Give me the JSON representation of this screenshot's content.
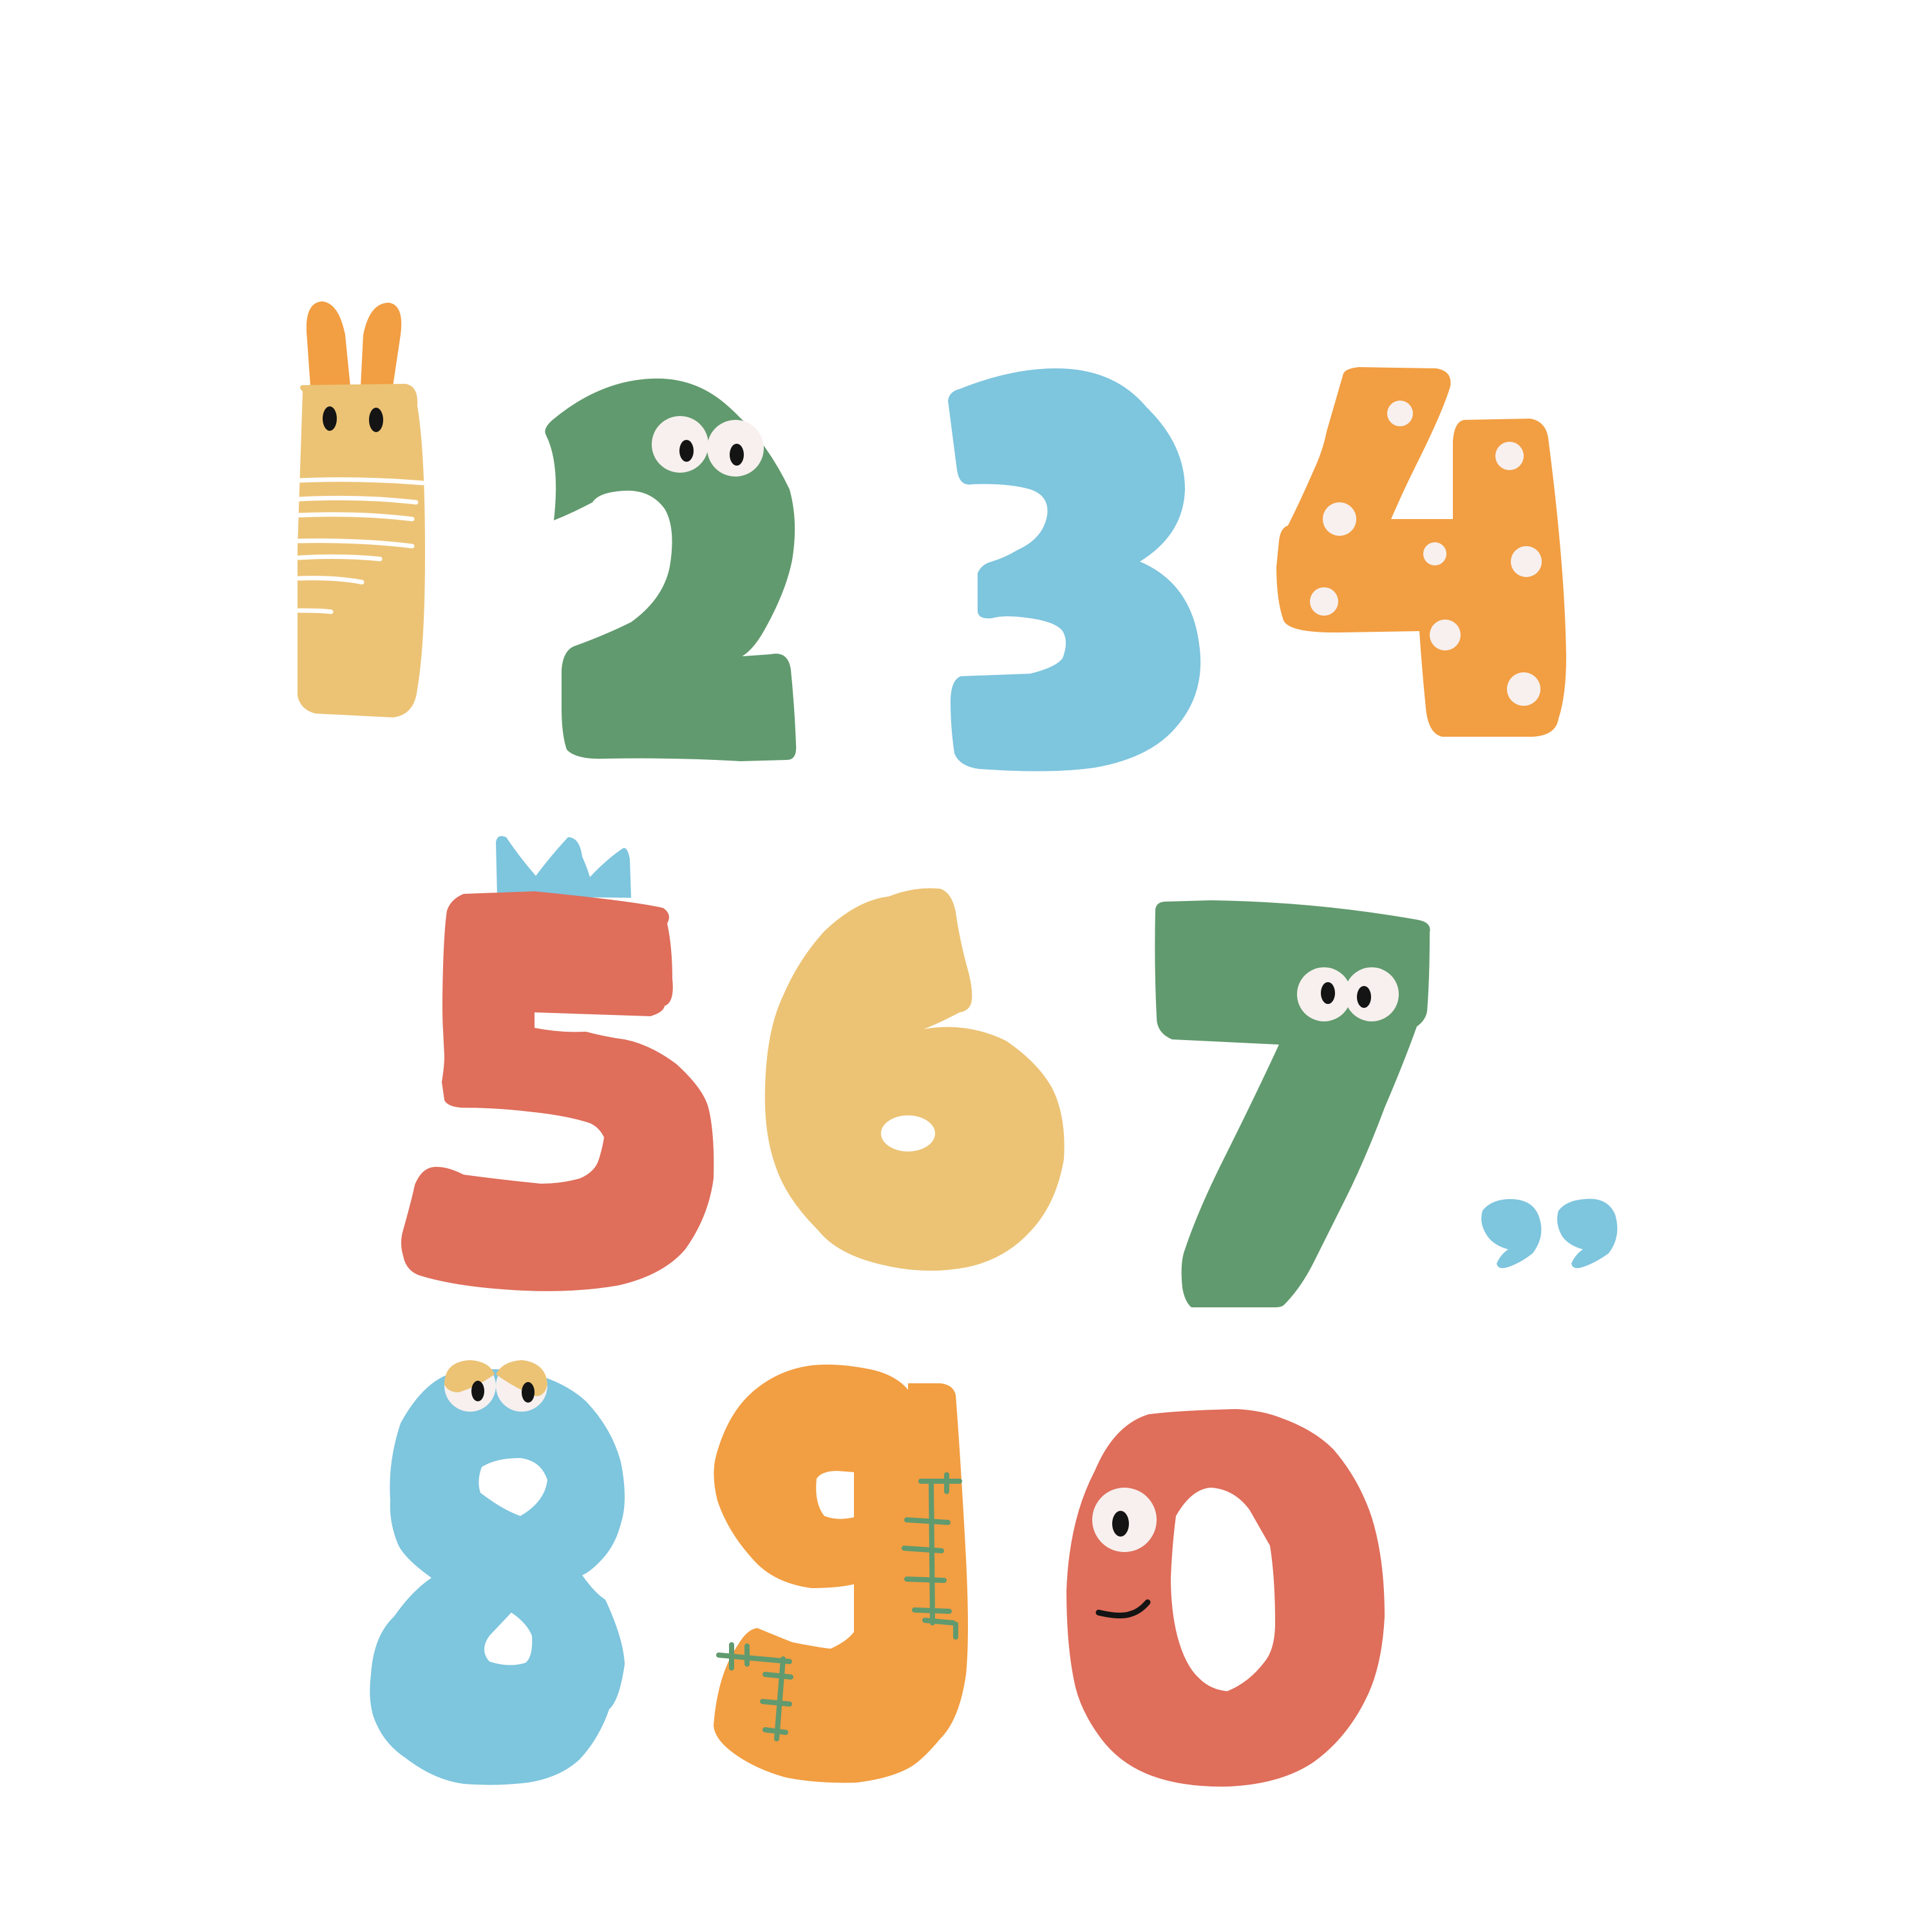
{
  "illustration": {
    "characters": [
      {
        "glyph": "1",
        "color": "#ECC375",
        "feature": "rabbit-ears-and-stripes"
      },
      {
        "glyph": "2",
        "color": "#619A6E",
        "feature": "googly-eyes"
      },
      {
        "glyph": "3",
        "color": "#7EC5DE",
        "feature": "plain"
      },
      {
        "glyph": "4",
        "color": "#F29E42",
        "feature": "polka-dots"
      },
      {
        "glyph": "5",
        "color": "#DF6E5B",
        "feature": "crown"
      },
      {
        "glyph": "6",
        "color": "#ECC375",
        "feature": "plain"
      },
      {
        "glyph": "7",
        "color": "#619A6E",
        "feature": "googly-eyes"
      },
      {
        "glyph": ",,",
        "color": "#7EC5DE",
        "feature": "commas"
      },
      {
        "glyph": "8",
        "color": "#7EC5DE",
        "feature": "sleepy-eyes"
      },
      {
        "glyph": "9",
        "color": "#F29E42",
        "feature": "stitches"
      },
      {
        "glyph": "0",
        "color": "#DF6E5B",
        "feature": "eye-and-smile"
      }
    ],
    "palette": {
      "yellow": "#ECC375",
      "green": "#619A6E",
      "blue": "#7EC5DE",
      "orange": "#F29E42",
      "red": "#DF6E5B",
      "eye_white": "#F7F0EE",
      "pupil": "#141414",
      "background": "#FFFFFF"
    }
  }
}
